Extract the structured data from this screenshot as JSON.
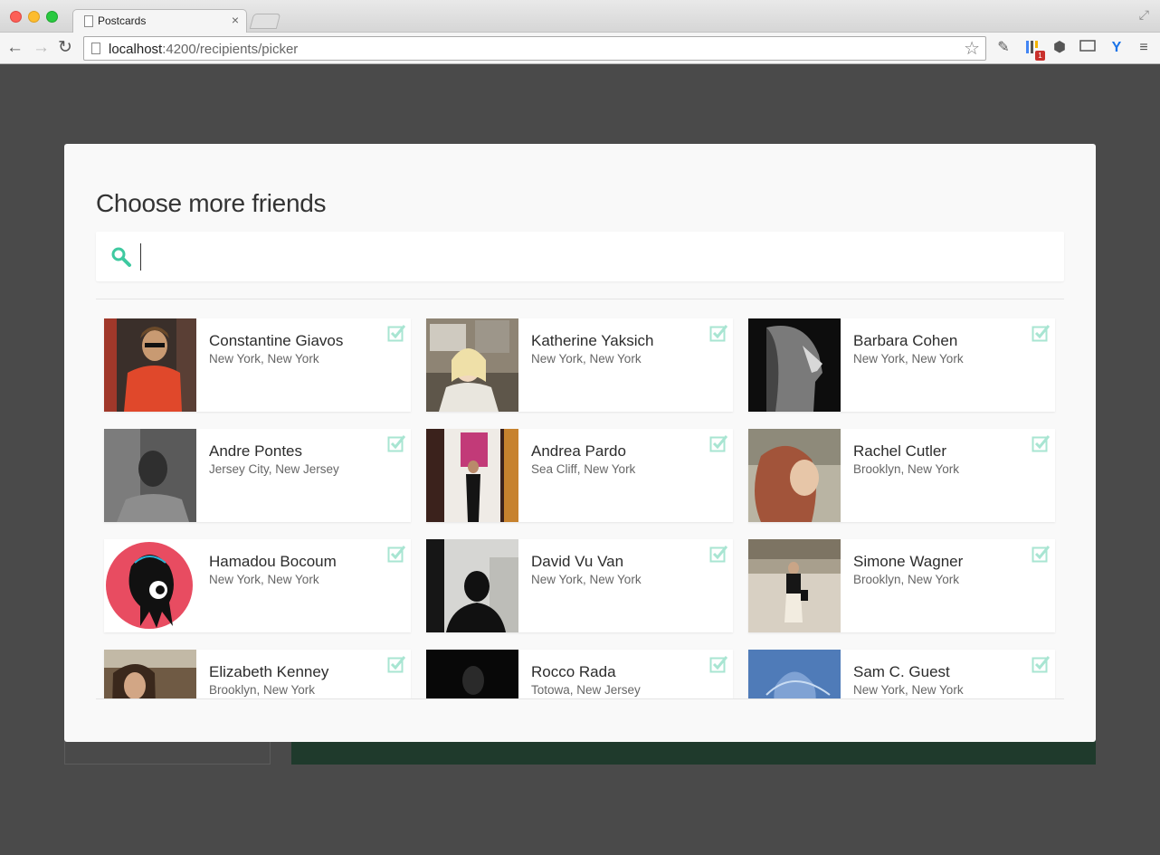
{
  "browser": {
    "tab_title": "Postcards",
    "tab_close": "×",
    "url_host": "localhost",
    "url_path": ":4200/recipients/picker",
    "back_icon": "arrow-left-icon",
    "forward_icon": "arrow-right-icon",
    "reload_icon": "reload-icon",
    "bookmark_icon": "star-icon",
    "ext_badge": "1"
  },
  "modal": {
    "title": "Choose more friends",
    "search": {
      "placeholder": "",
      "value": "",
      "icon": "search-icon"
    },
    "accent_color": "#3ec9a0",
    "check_color": "#a8e5d2"
  },
  "friends": [
    {
      "name": "Constantine Giavos",
      "location": "New York, New York",
      "selected": true
    },
    {
      "name": "Katherine Yaksich",
      "location": "New York, New York",
      "selected": true
    },
    {
      "name": "Barbara Cohen",
      "location": "New York, New York",
      "selected": true
    },
    {
      "name": "Andre Pontes",
      "location": "Jersey City, New Jersey",
      "selected": true
    },
    {
      "name": "Andrea Pardo",
      "location": "Sea Cliff, New York",
      "selected": true
    },
    {
      "name": "Rachel Cutler",
      "location": "Brooklyn, New York",
      "selected": true
    },
    {
      "name": "Hamadou Bocoum",
      "location": "New York, New York",
      "selected": true
    },
    {
      "name": "David Vu Van",
      "location": "New York, New York",
      "selected": true
    },
    {
      "name": "Simone Wagner",
      "location": "Brooklyn, New York",
      "selected": true
    },
    {
      "name": "Elizabeth Kenney",
      "location": "Brooklyn, New York",
      "selected": true
    },
    {
      "name": "Rocco Rada",
      "location": "Totowa, New Jersey",
      "selected": true
    },
    {
      "name": "Sam C. Guest",
      "location": "New York, New York",
      "selected": true
    }
  ]
}
